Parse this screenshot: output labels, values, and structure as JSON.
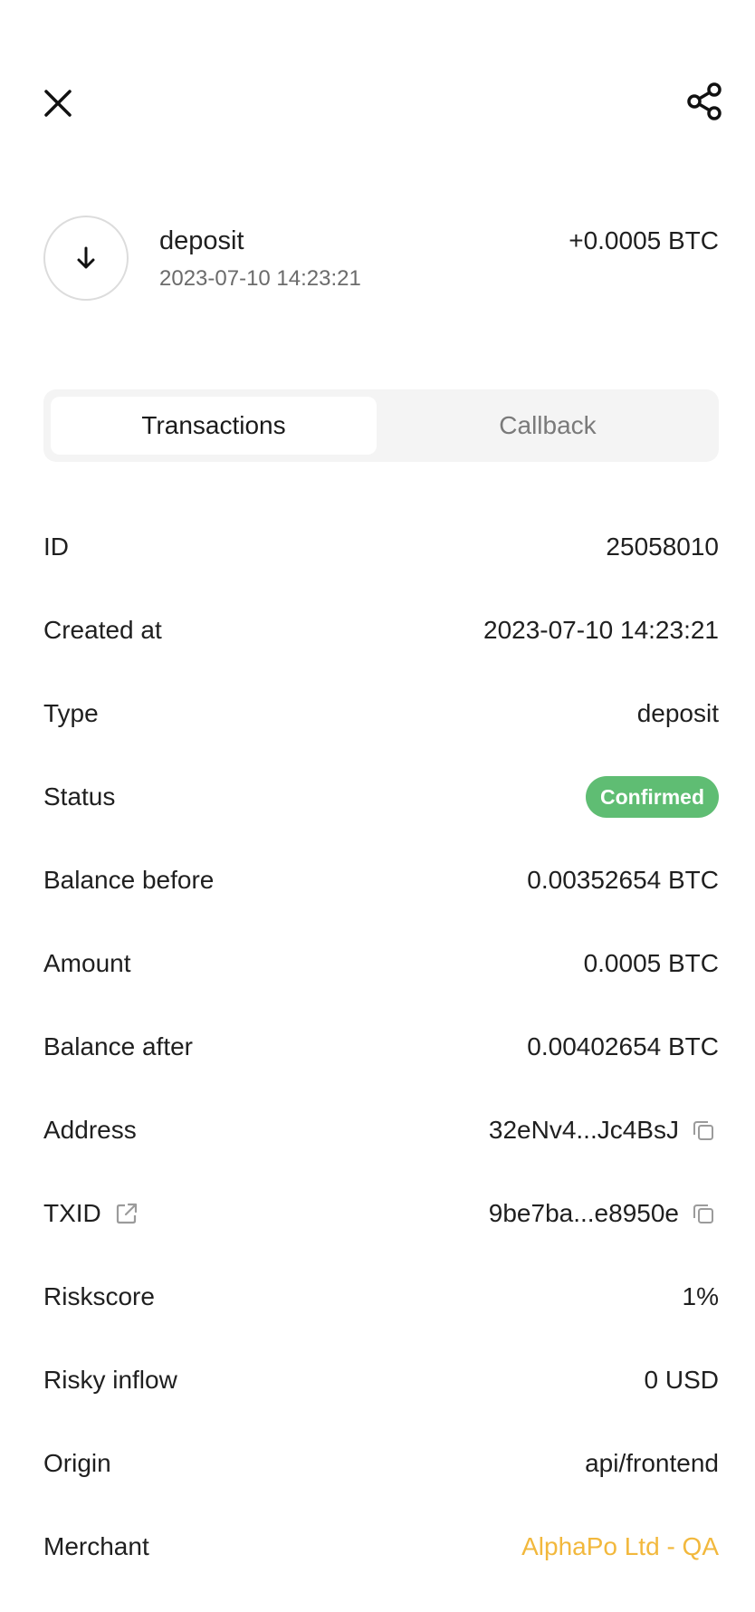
{
  "header": {
    "close_icon": "close-icon",
    "share_icon": "share-icon"
  },
  "transaction": {
    "type": "deposit",
    "date": "2023-07-10 14:23:21",
    "amount": "+0.0005 BTC",
    "icon": "arrow-down-icon"
  },
  "tabs": [
    {
      "label": "Transactions",
      "active": true
    },
    {
      "label": "Callback",
      "active": false
    }
  ],
  "details": {
    "id": {
      "label": "ID",
      "value": "25058010"
    },
    "created_at": {
      "label": "Created at",
      "value": "2023-07-10 14:23:21"
    },
    "type": {
      "label": "Type",
      "value": "deposit"
    },
    "status": {
      "label": "Status",
      "value": "Confirmed",
      "color": "#5fbd73"
    },
    "balance_before": {
      "label": "Balance before",
      "value": "0.00352654 BTC"
    },
    "amount": {
      "label": "Amount",
      "value": "0.0005 BTC"
    },
    "balance_after": {
      "label": "Balance after",
      "value": "0.00402654 BTC"
    },
    "address": {
      "label": "Address",
      "value": "32eNv4...Jc4BsJ",
      "icon": "copy-icon"
    },
    "txid": {
      "label": "TXID",
      "value": "9be7ba...e8950e",
      "label_icon": "external-link-icon",
      "icon": "copy-icon"
    },
    "riskscore": {
      "label": "Riskscore",
      "value": "1%"
    },
    "risky_inflow": {
      "label": "Risky inflow",
      "value": "0 USD"
    },
    "origin": {
      "label": "Origin",
      "value": "api/frontend"
    },
    "merchant": {
      "label": "Merchant",
      "value": "AlphaPo Ltd - QA",
      "color": "#f2b83c"
    }
  }
}
